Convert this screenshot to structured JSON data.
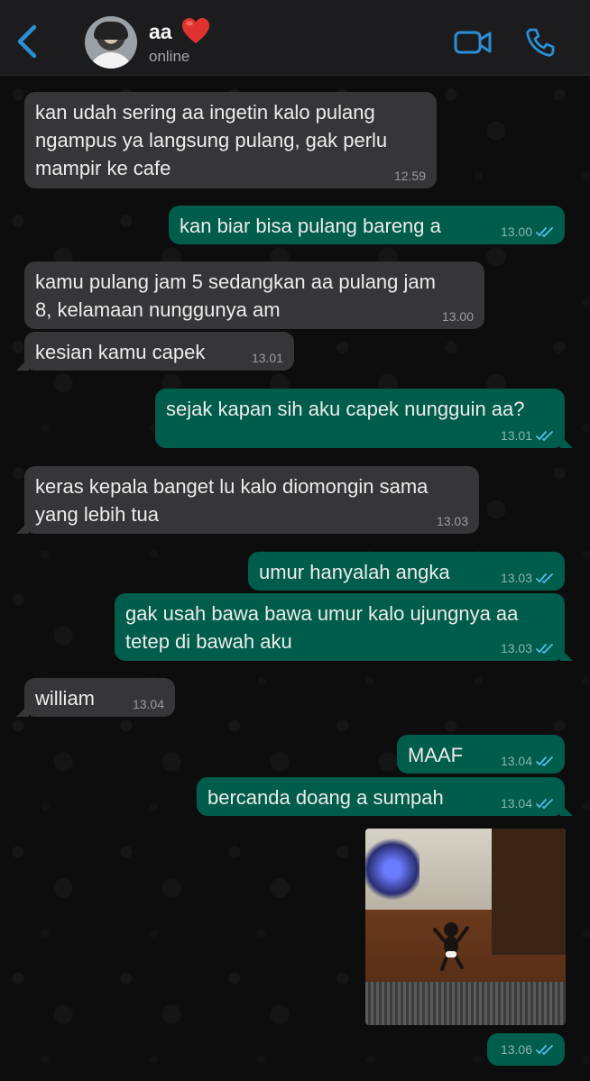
{
  "header": {
    "contact_name": "aa",
    "status": "online"
  },
  "colors": {
    "incoming_bubble": "#363638",
    "outgoing_bubble": "#005c4b",
    "accent": "#2a8fd6",
    "read_ticks": "#53bdeb"
  },
  "messages": [
    {
      "direction": "in",
      "lines": [
        "kan udah sering aa ingetin kalo pulang",
        "ngampus ya langsung pulang, gak perlu",
        "mampir ke cafe"
      ],
      "time": "12.59"
    },
    {
      "direction": "out",
      "lines": [
        "kan biar bisa pulang bareng a"
      ],
      "time": "13.00",
      "read": true
    },
    {
      "direction": "in",
      "lines": [
        "kamu pulang jam 5 sedangkan aa pulang jam",
        "8, kelamaan nunggunya am"
      ],
      "time": "13.00"
    },
    {
      "direction": "in",
      "lines": [
        "kesian kamu capek"
      ],
      "time": "13.01"
    },
    {
      "direction": "out",
      "lines": [
        "sejak kapan sih aku capek nungguin aa?"
      ],
      "time": "13.01",
      "read": true
    },
    {
      "direction": "in",
      "lines": [
        "keras kepala banget lu kalo diomongin sama",
        "yang lebih tua"
      ],
      "time": "13.03"
    },
    {
      "direction": "out",
      "lines": [
        "umur hanyalah angka"
      ],
      "time": "13.03",
      "read": true
    },
    {
      "direction": "out",
      "lines": [
        "gak usah bawa bawa umur kalo ujungnya aa",
        "tetep di bawah aku"
      ],
      "time": "13.03",
      "read": true
    },
    {
      "direction": "in",
      "lines": [
        "william"
      ],
      "time": "13.04"
    },
    {
      "direction": "out",
      "lines": [
        "MAAF"
      ],
      "time": "13.04",
      "read": true
    },
    {
      "direction": "out",
      "lines": [
        "bercanda doang a sumpah"
      ],
      "time": "13.04",
      "read": true
    },
    {
      "direction": "out",
      "type": "sticker",
      "time": "13.06",
      "read": true
    }
  ]
}
